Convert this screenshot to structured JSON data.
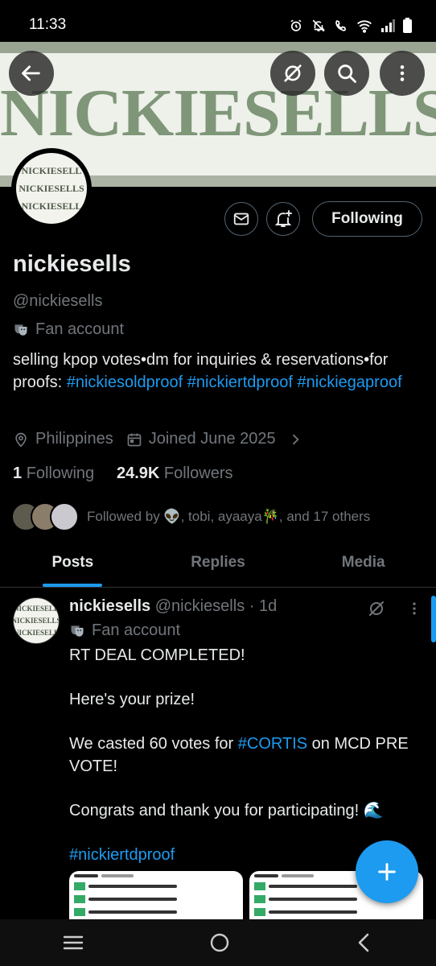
{
  "status_bar": {
    "time": "11:33"
  },
  "banner": {
    "text": "NICKIESELLS"
  },
  "avatar": {
    "lines": [
      "NICKIESELL",
      "NICKIESELLS",
      "NICKIESELL"
    ]
  },
  "profile": {
    "following_label": "Following",
    "name": "nickiesells",
    "handle": "@nickiesells",
    "category": "Fan account",
    "bio_text": "selling kpop votes•dm for inquiries & reservations•for proofs: ",
    "bio_tags": [
      "#nickiesoldproof",
      "#nickiertdproof",
      "#nickiegaproof"
    ],
    "location": "Philippines",
    "joined": "Joined June 2025",
    "following_count": "1",
    "following_word": "Following",
    "followers_count": "24.9K",
    "followers_word": "Followers",
    "followed_by": "Followed by 👽, tobi, ayaaya🎋, and 17 others"
  },
  "tabs": [
    "Posts",
    "Replies",
    "Media"
  ],
  "post": {
    "avatar_lines": [
      "NICKIESELL",
      "NICKIESELLS",
      "NICKIESELL"
    ],
    "name": "nickiesells",
    "handle_time": "@nickiesells · 1d",
    "category": "Fan account",
    "line1": "RT DEAL COMPLETED!",
    "line2": "Here's your prize!",
    "line3_pre": "We casted 60 votes for ",
    "line3_tag": "#CORTIS",
    "line3_post": " on MCD PRE VOTE!",
    "line4": "Congrats and thank you for participating! 🌊",
    "tag": "#nickiertdproof"
  },
  "colors": {
    "accent": "#1d9bf0",
    "background": "#000000",
    "muted": "#71767b"
  }
}
